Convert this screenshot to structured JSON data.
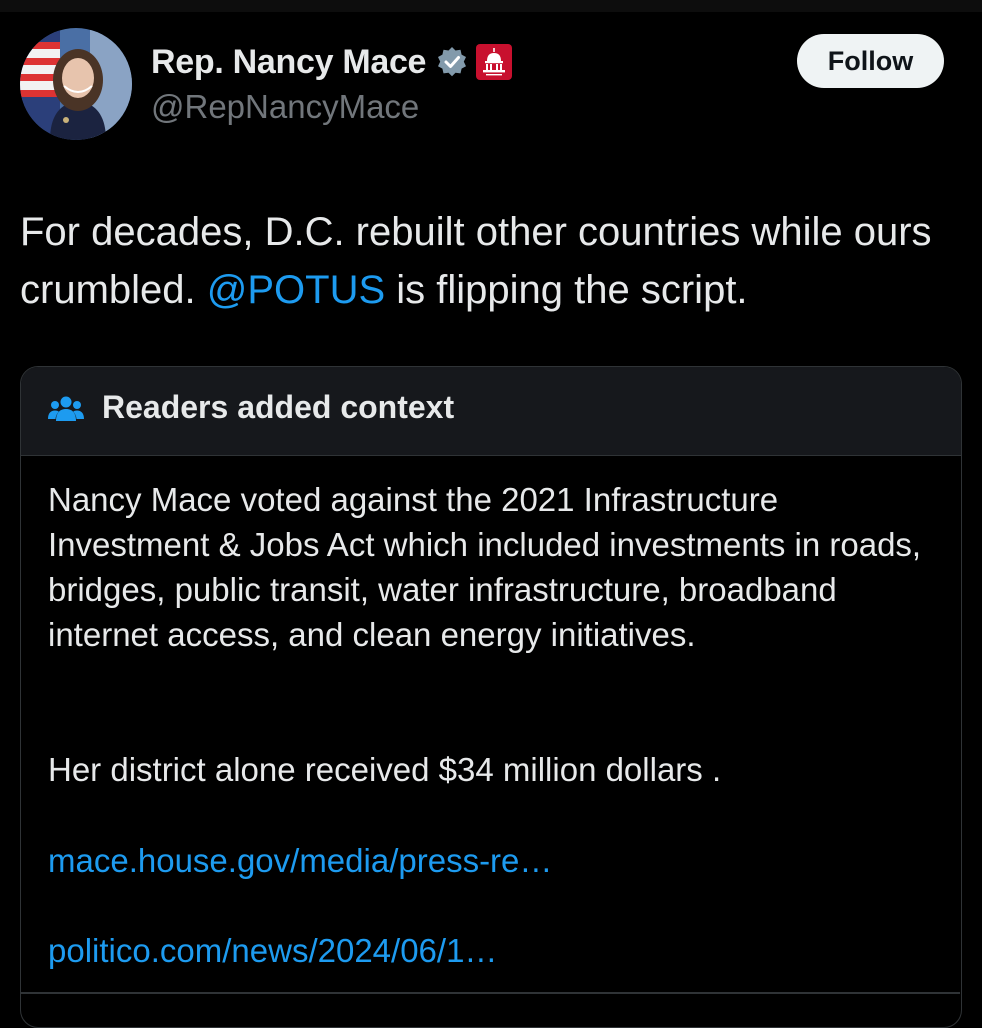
{
  "author": {
    "display_name": "Rep. Nancy Mace",
    "handle": "@RepNancyMace",
    "verified_badge": "verified-badge-icon",
    "affiliation_badge": "capitol-badge-icon"
  },
  "follow_button": {
    "label": "Follow"
  },
  "tweet": {
    "text_before": "For decades, D.C. rebuilt other countries while ours crumbled. ",
    "mention": "@POTUS",
    "text_after": " is flipping the script."
  },
  "community_note": {
    "header": "Readers added context",
    "paragraph_1": "Nancy Mace voted against the 2021 Infrastructure Investment & Jobs Act which included investments in roads, bridges, public transit, water infrastructure, broadband internet access, and clean energy initiatives.",
    "paragraph_2": "Her district alone received $34 million dollars .",
    "links": [
      "mace.house.gov/media/press-re…",
      "politico.com/news/2024/06/1…"
    ]
  },
  "colors": {
    "background": "#000000",
    "text_primary": "#e7e9ea",
    "text_secondary": "#71767b",
    "link": "#1d9bf0",
    "note_header_bg": "#16181c",
    "border": "#2f3336",
    "follow_bg": "#eff3f4"
  }
}
